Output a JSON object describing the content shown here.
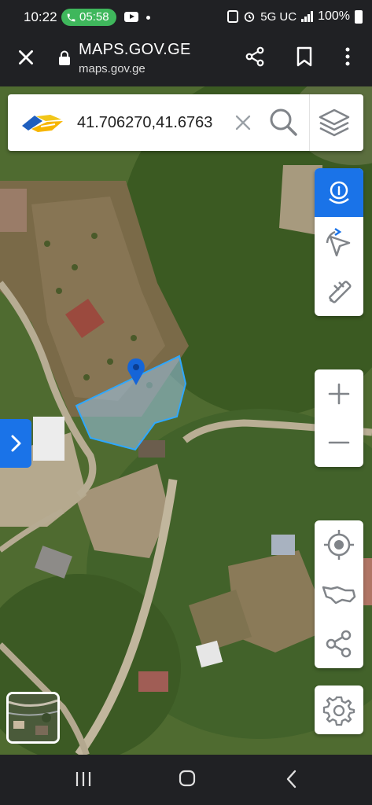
{
  "status_bar": {
    "time": "10:22",
    "call_timer": "05:58",
    "network": "5G UC",
    "battery": "100%"
  },
  "browser": {
    "title": "MAPS.GOV.GE",
    "url": "maps.gov.ge"
  },
  "search": {
    "value": "41.706270,41.6763"
  },
  "colors": {
    "accent": "#1a73e8",
    "parcel_stroke": "#2ea8ff",
    "parcel_fill": "#9ac4e8",
    "pin": "#1565d8",
    "icon_gray": "#808489"
  },
  "icons": {
    "search_bar": [
      "app-logo",
      "clear-icon",
      "search-icon",
      "layers-icon"
    ],
    "tools": [
      "info-pin-icon",
      "compass-icon",
      "measure-icon"
    ],
    "zoom": [
      "zoom-in-icon",
      "zoom-out-icon"
    ],
    "location": [
      "my-location-icon",
      "georgia-map-icon",
      "share-icon"
    ],
    "settings": [
      "gear-icon"
    ]
  }
}
